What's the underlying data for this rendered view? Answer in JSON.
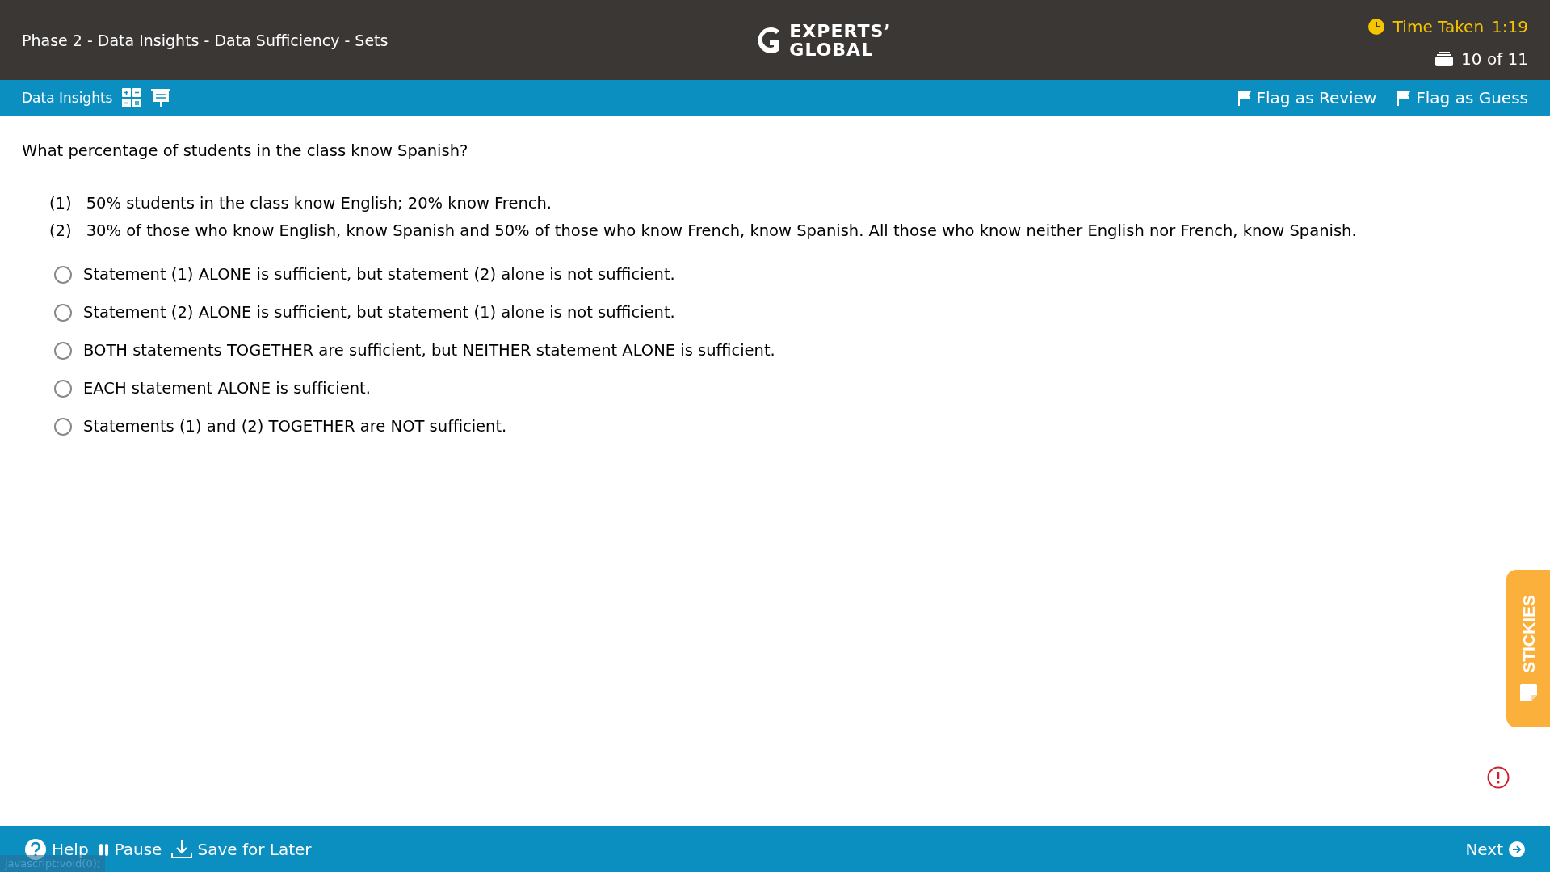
{
  "header": {
    "title": "Phase 2 - Data Insights - Data Sufficiency - Sets",
    "logo": {
      "line_1": "EXPERTS’",
      "line_2": "GLOBAL"
    },
    "timer": {
      "label": "Time Taken",
      "value": "1:19"
    },
    "progress": "10 of 11"
  },
  "toolbar": {
    "section": "Data Insights",
    "flags": [
      "Flag as Review",
      "Flag as Guess"
    ]
  },
  "question": {
    "text": "What percentage of students in the class know Spanish?",
    "statements": [
      {
        "number": "(1)",
        "text": "50% students in the class know English; 20% know French."
      },
      {
        "number": "(2)",
        "text": "30% of those who know English, know Spanish and 50% of those who know French, know Spanish. All those who know neither English nor French, know Spanish."
      }
    ],
    "options": [
      {
        "text": "Statement (1) ALONE is sufficient, but statement (2) alone is not sufficient.",
        "selected": false
      },
      {
        "text": "Statement (2) ALONE is sufficient, but statement (1) alone is not sufficient.",
        "selected": false
      },
      {
        "text": "BOTH statements TOGETHER are sufficient, but NEITHER statement ALONE is sufficient.",
        "selected": false
      },
      {
        "text": "EACH statement ALONE is sufficient.",
        "selected": false
      },
      {
        "text": "Statements (1) and (2) TOGETHER are NOT sufficient.",
        "selected": false
      }
    ]
  },
  "stickies": "STICKIES",
  "footer": {
    "buttons": [
      "Help",
      "Pause",
      "Save for Later"
    ],
    "next": "Next"
  },
  "status_bar": "javascript:void(0);"
}
